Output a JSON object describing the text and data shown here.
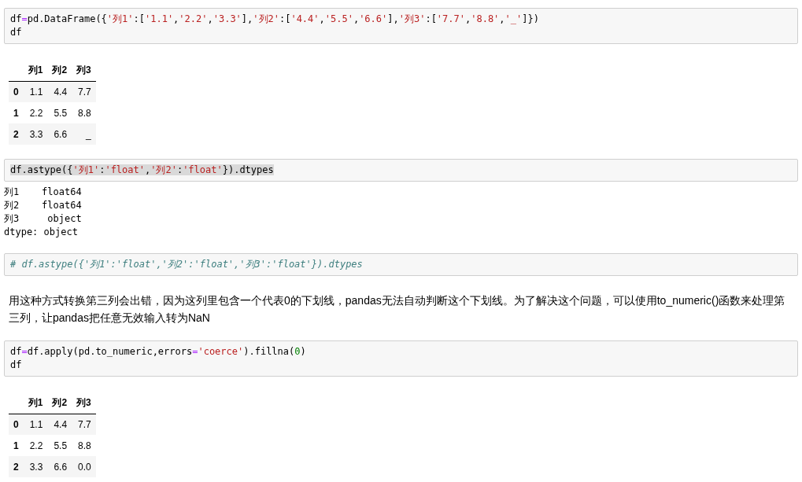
{
  "cells": [
    {
      "kind": "code",
      "highlighted": false,
      "lines": [
        [
          {
            "text": "df",
            "kind": "plain"
          },
          {
            "text": "=",
            "kind": "operator"
          },
          {
            "text": "pd.DataFrame({",
            "kind": "plain"
          },
          {
            "text": "'列1'",
            "kind": "string"
          },
          {
            "text": ":[",
            "kind": "plain"
          },
          {
            "text": "'1.1'",
            "kind": "string"
          },
          {
            "text": ",",
            "kind": "plain"
          },
          {
            "text": "'2.2'",
            "kind": "string"
          },
          {
            "text": ",",
            "kind": "plain"
          },
          {
            "text": "'3.3'",
            "kind": "string"
          },
          {
            "text": "],",
            "kind": "plain"
          },
          {
            "text": "'列2'",
            "kind": "string"
          },
          {
            "text": ":[",
            "kind": "plain"
          },
          {
            "text": "'4.4'",
            "kind": "string"
          },
          {
            "text": ",",
            "kind": "plain"
          },
          {
            "text": "'5.5'",
            "kind": "string"
          },
          {
            "text": ",",
            "kind": "plain"
          },
          {
            "text": "'6.6'",
            "kind": "string"
          },
          {
            "text": "],",
            "kind": "plain"
          },
          {
            "text": "'列3'",
            "kind": "string"
          },
          {
            "text": ":[",
            "kind": "plain"
          },
          {
            "text": "'7.7'",
            "kind": "string"
          },
          {
            "text": ",",
            "kind": "plain"
          },
          {
            "text": "'8.8'",
            "kind": "string"
          },
          {
            "text": ",",
            "kind": "plain"
          },
          {
            "text": "'_'",
            "kind": "string"
          },
          {
            "text": "]})",
            "kind": "plain"
          }
        ],
        [
          {
            "text": "df",
            "kind": "plain"
          }
        ]
      ]
    },
    {
      "kind": "table",
      "columns": [
        "列1",
        "列2",
        "列3"
      ],
      "rows": [
        {
          "index": "0",
          "cells": [
            "1.1",
            "4.4",
            "7.7"
          ]
        },
        {
          "index": "1",
          "cells": [
            "2.2",
            "5.5",
            "8.8"
          ]
        },
        {
          "index": "2",
          "cells": [
            "3.3",
            "6.6",
            "_"
          ]
        }
      ]
    },
    {
      "kind": "code",
      "highlighted": true,
      "lines": [
        [
          {
            "text": "df.astype({",
            "kind": "plain"
          },
          {
            "text": "'列1'",
            "kind": "string"
          },
          {
            "text": ":",
            "kind": "plain"
          },
          {
            "text": "'float'",
            "kind": "string"
          },
          {
            "text": ",",
            "kind": "plain"
          },
          {
            "text": "'列2'",
            "kind": "string"
          },
          {
            "text": ":",
            "kind": "plain"
          },
          {
            "text": "'float'",
            "kind": "string"
          },
          {
            "text": "}).dtypes",
            "kind": "plain"
          }
        ]
      ]
    },
    {
      "kind": "text",
      "lines": [
        "列1    float64",
        "列2    float64",
        "列3     object",
        "dtype: object"
      ]
    },
    {
      "kind": "code",
      "highlighted": false,
      "lines": [
        [
          {
            "text": "# df.astype({'列1':'float','列2':'float','列3':'float'}).dtypes",
            "kind": "comment"
          }
        ]
      ]
    },
    {
      "kind": "markdown",
      "text": "用这种方式转换第三列会出错，因为这列里包含一个代表0的下划线，pandas无法自动判断这个下划线。为了解决这个问题，可以使用to_numeric()函数来处理第三列，让pandas把任意无效输入转为NaN"
    },
    {
      "kind": "code",
      "highlighted": false,
      "lines": [
        [
          {
            "text": "df",
            "kind": "plain"
          },
          {
            "text": "=",
            "kind": "operator"
          },
          {
            "text": "df.apply(pd.to_numeric,errors",
            "kind": "plain"
          },
          {
            "text": "=",
            "kind": "operator"
          },
          {
            "text": "'coerce'",
            "kind": "string"
          },
          {
            "text": ").fillna(",
            "kind": "plain"
          },
          {
            "text": "0",
            "kind": "number"
          },
          {
            "text": ")",
            "kind": "plain"
          }
        ],
        [
          {
            "text": "df",
            "kind": "plain"
          }
        ]
      ]
    },
    {
      "kind": "table",
      "columns": [
        "列1",
        "列2",
        "列3"
      ],
      "rows": [
        {
          "index": "0",
          "cells": [
            "1.1",
            "4.4",
            "7.7"
          ]
        },
        {
          "index": "1",
          "cells": [
            "2.2",
            "5.5",
            "8.8"
          ]
        },
        {
          "index": "2",
          "cells": [
            "3.3",
            "6.6",
            "0.0"
          ]
        }
      ]
    }
  ]
}
